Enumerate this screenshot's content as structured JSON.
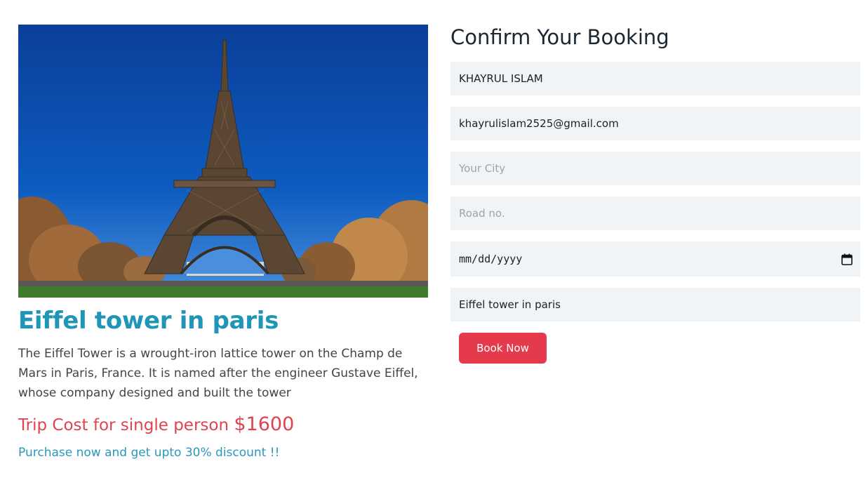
{
  "tour": {
    "image_alt": "Eiffel tower in paris photo",
    "title": "Eiffel tower in paris",
    "description": "The Eiffel Tower is a wrought-iron lattice tower on the Champ de Mars in Paris, France. It is named after the engineer Gustave Eiffel, whose company designed and built the tower",
    "cost_label": "Trip Cost for single person ",
    "cost_amount": "$1600",
    "discount_text": "Purchase now and get upto 30% discount !!"
  },
  "booking": {
    "heading": "Confirm Your Booking",
    "name_value": "KHAYRUL ISLAM",
    "email_value": "khayrulislam2525@gmail.com",
    "city_placeholder": "Your City",
    "road_placeholder": "Road no.",
    "date_placeholder": "mm/dd/yyyy",
    "place_value": "Eiffel tower in paris",
    "submit_label": "Book Now"
  },
  "colors": {
    "title": "#1f96b8",
    "cost": "#e0434f",
    "button": "#e43a4b",
    "field_bg": "#f0f4f6"
  }
}
